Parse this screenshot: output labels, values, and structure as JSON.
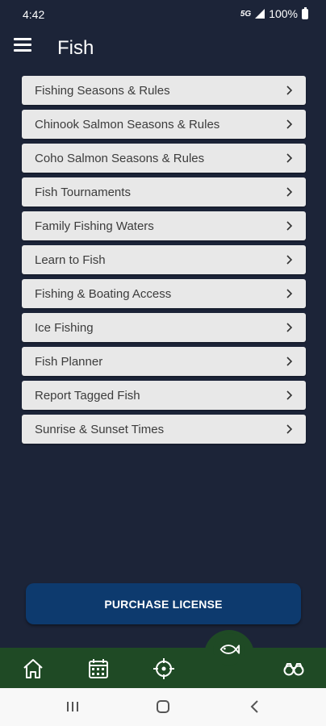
{
  "status_bar": {
    "time": "4:42",
    "network": "5G",
    "battery": "100%"
  },
  "header": {
    "title": "Fish"
  },
  "menu": {
    "items": [
      {
        "label": "Fishing Seasons & Rules"
      },
      {
        "label": "Chinook Salmon Seasons & Rules"
      },
      {
        "label": "Coho Salmon Seasons & Rules"
      },
      {
        "label": "Fish Tournaments"
      },
      {
        "label": "Family Fishing Waters"
      },
      {
        "label": "Learn to Fish"
      },
      {
        "label": "Fishing & Boating Access"
      },
      {
        "label": "Ice Fishing"
      },
      {
        "label": "Fish Planner"
      },
      {
        "label": "Report Tagged Fish"
      },
      {
        "label": "Sunrise & Sunset Times"
      }
    ]
  },
  "purchase_button": {
    "label": "PURCHASE LICENSE"
  },
  "bottom_nav": {
    "items": [
      "home-icon",
      "calendar-icon",
      "crosshair-icon",
      "fish-icon",
      "binoculars-icon"
    ],
    "active": "fish-icon"
  },
  "colors": {
    "background": "#1c2438",
    "menu_item": "#e8e8e8",
    "button": "#0d3a6e",
    "nav": "#1f4a25"
  }
}
